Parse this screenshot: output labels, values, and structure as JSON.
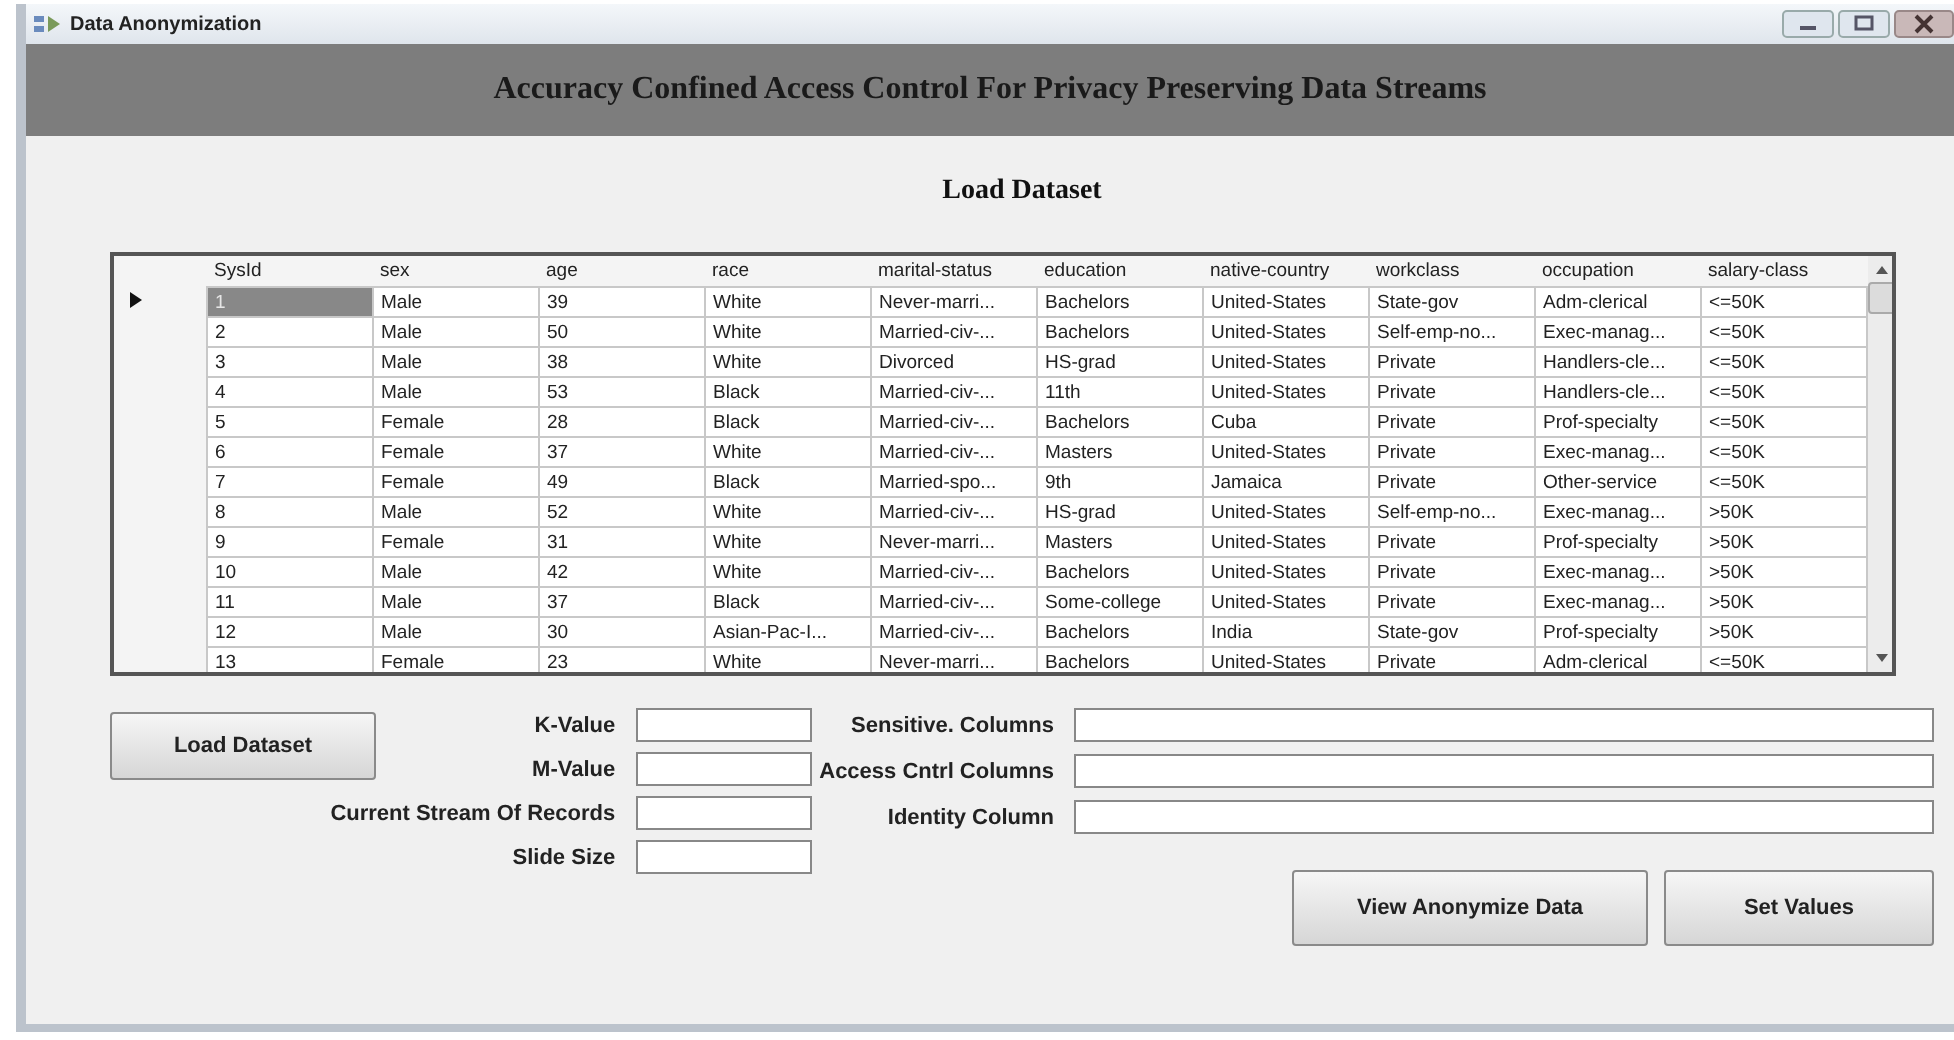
{
  "window": {
    "title": "Data Anonymization"
  },
  "banner": {
    "title": "Accuracy Confined Access Control For Privacy Preserving Data Streams"
  },
  "section_title": "Load Dataset",
  "table": {
    "columns": [
      "SysId",
      "sex",
      "age",
      "race",
      "marital-status",
      "education",
      "native-country",
      "workclass",
      "occupation",
      "salary-class"
    ],
    "rows": [
      {
        "selected": true,
        "cells": [
          "1",
          "Male",
          "39",
          "White",
          "Never-marri...",
          "Bachelors",
          "United-States",
          "State-gov",
          "Adm-clerical",
          "<=50K"
        ]
      },
      {
        "selected": false,
        "cells": [
          "2",
          "Male",
          "50",
          "White",
          "Married-civ-...",
          "Bachelors",
          "United-States",
          "Self-emp-no...",
          "Exec-manag...",
          "<=50K"
        ]
      },
      {
        "selected": false,
        "cells": [
          "3",
          "Male",
          "38",
          "White",
          "Divorced",
          "HS-grad",
          "United-States",
          "Private",
          "Handlers-cle...",
          "<=50K"
        ]
      },
      {
        "selected": false,
        "cells": [
          "4",
          "Male",
          "53",
          "Black",
          "Married-civ-...",
          "11th",
          "United-States",
          "Private",
          "Handlers-cle...",
          "<=50K"
        ]
      },
      {
        "selected": false,
        "cells": [
          "5",
          "Female",
          "28",
          "Black",
          "Married-civ-...",
          "Bachelors",
          "Cuba",
          "Private",
          "Prof-specialty",
          "<=50K"
        ]
      },
      {
        "selected": false,
        "cells": [
          "6",
          "Female",
          "37",
          "White",
          "Married-civ-...",
          "Masters",
          "United-States",
          "Private",
          "Exec-manag...",
          "<=50K"
        ]
      },
      {
        "selected": false,
        "cells": [
          "7",
          "Female",
          "49",
          "Black",
          "Married-spo...",
          "9th",
          "Jamaica",
          "Private",
          "Other-service",
          "<=50K"
        ]
      },
      {
        "selected": false,
        "cells": [
          "8",
          "Male",
          "52",
          "White",
          "Married-civ-...",
          "HS-grad",
          "United-States",
          "Self-emp-no...",
          "Exec-manag...",
          ">50K"
        ]
      },
      {
        "selected": false,
        "cells": [
          "9",
          "Female",
          "31",
          "White",
          "Never-marri...",
          "Masters",
          "United-States",
          "Private",
          "Prof-specialty",
          ">50K"
        ]
      },
      {
        "selected": false,
        "cells": [
          "10",
          "Male",
          "42",
          "White",
          "Married-civ-...",
          "Bachelors",
          "United-States",
          "Private",
          "Exec-manag...",
          ">50K"
        ]
      },
      {
        "selected": false,
        "cells": [
          "11",
          "Male",
          "37",
          "Black",
          "Married-civ-...",
          "Some-college",
          "United-States",
          "Private",
          "Exec-manag...",
          ">50K"
        ]
      },
      {
        "selected": false,
        "cells": [
          "12",
          "Male",
          "30",
          "Asian-Pac-I...",
          "Married-civ-...",
          "Bachelors",
          "India",
          "State-gov",
          "Prof-specialty",
          ">50K"
        ]
      },
      {
        "selected": false,
        "cells": [
          "13",
          "Female",
          "23",
          "White",
          "Never-marri...",
          "Bachelors",
          "United-States",
          "Private",
          "Adm-clerical",
          "<=50K"
        ]
      }
    ]
  },
  "load_button": "Load Dataset",
  "left_fields": [
    {
      "label": "K-Value"
    },
    {
      "label": "M-Value"
    },
    {
      "label": "Current Stream Of Records"
    },
    {
      "label": "Slide Size"
    }
  ],
  "right_fields": [
    {
      "label": "Sensitive. Columns"
    },
    {
      "label": "Access Cntrl Columns"
    },
    {
      "label": "Identity Column"
    }
  ],
  "buttons": [
    "View Anonymize Data",
    "Set Values"
  ]
}
